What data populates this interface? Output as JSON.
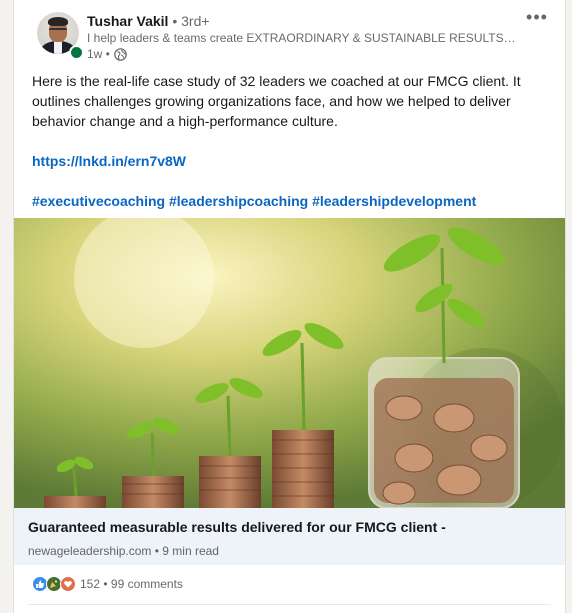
{
  "author": {
    "name": "Tushar Vakil",
    "degree": " • 3rd+",
    "headline": "I help leaders & teams create EXTRAORDINARY & SUSTAINABLE RESULTS…",
    "time": "1w •"
  },
  "post": {
    "text": "Here is the real-life case study of 32 leaders we coached at our FMCG client. It outlines challenges growing organizations face, and how we helped to deliver behavior change and a high-performance culture.",
    "link": "https://lnkd.in/ern7v8W",
    "hashtags": [
      "#executivecoaching",
      "#leadershipcoaching",
      "#leadershipdevelopment"
    ]
  },
  "article": {
    "title": "Guaranteed measurable results delivered for our FMCG client -",
    "source": "newageleadership.com • 9 min read"
  },
  "social": {
    "reaction_icons": [
      "like-icon",
      "celebrate-icon",
      "love-icon"
    ],
    "reactions_count": "152",
    "separator": " • ",
    "comments": "99 comments"
  },
  "colors": {
    "link": "#0a66c2",
    "online": "#057642",
    "article_footer_bg": "#eef3f8"
  }
}
